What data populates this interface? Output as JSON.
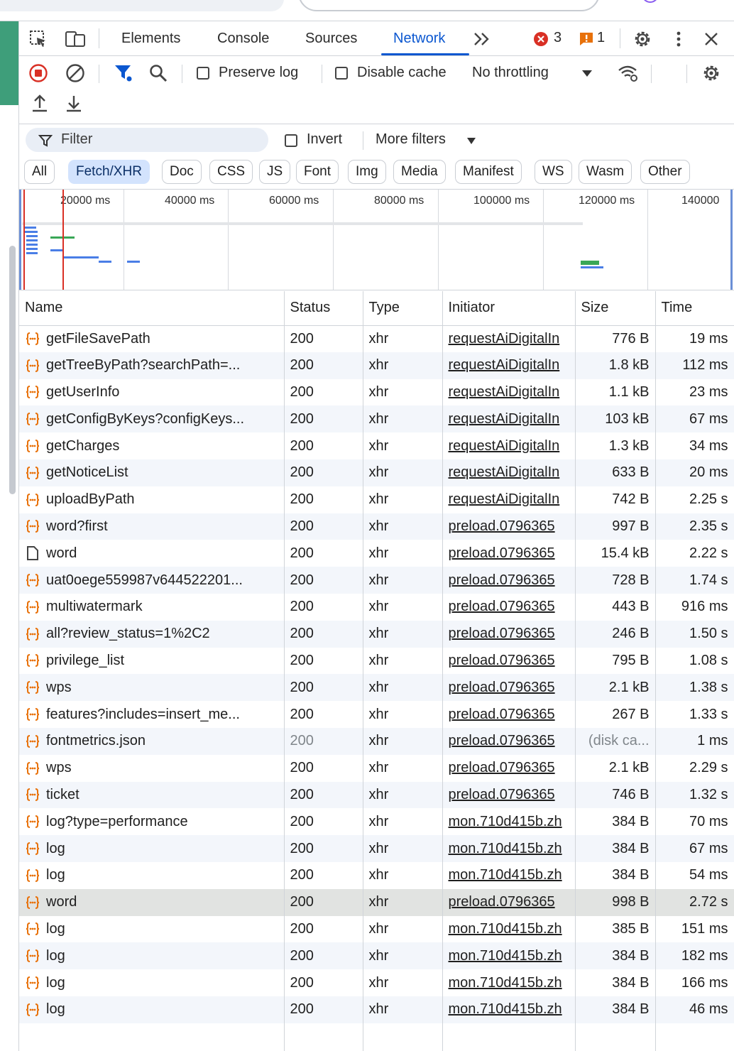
{
  "devtools": {
    "tabs": [
      "Elements",
      "Console",
      "Sources",
      "Network"
    ],
    "active_tab": "Network",
    "error_count": "3",
    "warning_count": "1"
  },
  "toolbar": {
    "preserve_log": "Preserve log",
    "disable_cache": "Disable cache",
    "throttling": "No throttling"
  },
  "filter": {
    "placeholder": "Filter",
    "invert": "Invert",
    "more_filters": "More filters",
    "chips": [
      "All",
      "Fetch/XHR",
      "Doc",
      "CSS",
      "JS",
      "Font",
      "Img",
      "Media",
      "Manifest",
      "WS",
      "Wasm",
      "Other"
    ],
    "active_chip": "Fetch/XHR"
  },
  "timeline": {
    "labels": [
      "20000 ms",
      "40000 ms",
      "60000 ms",
      "80000 ms",
      "100000 ms",
      "120000 ms",
      "140000"
    ]
  },
  "table": {
    "columns": [
      "Name",
      "Status",
      "Type",
      "Initiator",
      "Size",
      "Time"
    ],
    "rows": [
      {
        "icon": "fetch-icon",
        "name": "getFileSavePath",
        "status": "200",
        "type": "xhr",
        "initiator": "requestAiDigitalIn",
        "size": "776 B",
        "time": "19 ms"
      },
      {
        "icon": "fetch-icon",
        "name": "getTreeByPath?searchPath=...",
        "status": "200",
        "type": "xhr",
        "initiator": "requestAiDigitalIn",
        "size": "1.8 kB",
        "time": "112 ms"
      },
      {
        "icon": "fetch-icon",
        "name": "getUserInfo",
        "status": "200",
        "type": "xhr",
        "initiator": "requestAiDigitalIn",
        "size": "1.1 kB",
        "time": "23 ms"
      },
      {
        "icon": "fetch-icon",
        "name": "getConfigByKeys?configKeys...",
        "status": "200",
        "type": "xhr",
        "initiator": "requestAiDigitalIn",
        "size": "103 kB",
        "time": "67 ms"
      },
      {
        "icon": "fetch-icon",
        "name": "getCharges",
        "status": "200",
        "type": "xhr",
        "initiator": "requestAiDigitalIn",
        "size": "1.3 kB",
        "time": "34 ms"
      },
      {
        "icon": "fetch-icon",
        "name": "getNoticeList",
        "status": "200",
        "type": "xhr",
        "initiator": "requestAiDigitalIn",
        "size": "633 B",
        "time": "20 ms"
      },
      {
        "icon": "fetch-icon",
        "name": "uploadByPath",
        "status": "200",
        "type": "xhr",
        "initiator": "requestAiDigitalIn",
        "size": "742 B",
        "time": "2.25 s"
      },
      {
        "icon": "fetch-icon",
        "name": "word?first",
        "status": "200",
        "type": "xhr",
        "initiator": "preload.0796365",
        "size": "997 B",
        "time": "2.35 s"
      },
      {
        "icon": "document-icon",
        "name": "word",
        "status": "200",
        "type": "xhr",
        "initiator": "preload.0796365",
        "size": "15.4 kB",
        "time": "2.22 s"
      },
      {
        "icon": "fetch-icon",
        "name": "uat0oege559987v644522201...",
        "status": "200",
        "type": "xhr",
        "initiator": "preload.0796365",
        "size": "728 B",
        "time": "1.74 s"
      },
      {
        "icon": "fetch-icon",
        "name": "multiwatermark",
        "status": "200",
        "type": "xhr",
        "initiator": "preload.0796365",
        "size": "443 B",
        "time": "916 ms"
      },
      {
        "icon": "fetch-icon",
        "name": "all?review_status=1%2C2",
        "status": "200",
        "type": "xhr",
        "initiator": "preload.0796365",
        "size": "246 B",
        "time": "1.50 s"
      },
      {
        "icon": "fetch-icon",
        "name": "privilege_list",
        "status": "200",
        "type": "xhr",
        "initiator": "preload.0796365",
        "size": "795 B",
        "time": "1.08 s"
      },
      {
        "icon": "fetch-icon",
        "name": "wps",
        "status": "200",
        "type": "xhr",
        "initiator": "preload.0796365",
        "size": "2.1 kB",
        "time": "1.38 s"
      },
      {
        "icon": "fetch-icon",
        "name": "features?includes=insert_me...",
        "status": "200",
        "type": "xhr",
        "initiator": "preload.0796365",
        "size": "267 B",
        "time": "1.33 s"
      },
      {
        "icon": "fetch-icon",
        "name": "fontmetrics.json",
        "status": "200",
        "type": "xhr",
        "initiator": "preload.0796365",
        "size": "(disk ca...",
        "time": "1 ms",
        "cached": true
      },
      {
        "icon": "fetch-icon",
        "name": "wps",
        "status": "200",
        "type": "xhr",
        "initiator": "preload.0796365",
        "size": "2.1 kB",
        "time": "2.29 s"
      },
      {
        "icon": "fetch-icon",
        "name": "ticket",
        "status": "200",
        "type": "xhr",
        "initiator": "preload.0796365",
        "size": "746 B",
        "time": "1.32 s"
      },
      {
        "icon": "fetch-icon",
        "name": "log?type=performance",
        "status": "200",
        "type": "xhr",
        "initiator": "mon.710d415b.zh",
        "size": "384 B",
        "time": "70 ms"
      },
      {
        "icon": "fetch-icon",
        "name": "log",
        "status": "200",
        "type": "xhr",
        "initiator": "mon.710d415b.zh",
        "size": "384 B",
        "time": "67 ms"
      },
      {
        "icon": "fetch-icon",
        "name": "log",
        "status": "200",
        "type": "xhr",
        "initiator": "mon.710d415b.zh",
        "size": "384 B",
        "time": "54 ms"
      },
      {
        "icon": "fetch-icon",
        "name": "word",
        "status": "200",
        "type": "xhr",
        "initiator": "preload.0796365",
        "size": "998 B",
        "time": "2.72 s",
        "selected": true
      },
      {
        "icon": "fetch-icon",
        "name": "log",
        "status": "200",
        "type": "xhr",
        "initiator": "mon.710d415b.zh",
        "size": "385 B",
        "time": "151 ms"
      },
      {
        "icon": "fetch-icon",
        "name": "log",
        "status": "200",
        "type": "xhr",
        "initiator": "mon.710d415b.zh",
        "size": "384 B",
        "time": "182 ms"
      },
      {
        "icon": "fetch-icon",
        "name": "log",
        "status": "200",
        "type": "xhr",
        "initiator": "mon.710d415b.zh",
        "size": "384 B",
        "time": "166 ms"
      },
      {
        "icon": "fetch-icon",
        "name": "log",
        "status": "200",
        "type": "xhr",
        "initiator": "mon.710d415b.zh",
        "size": "384 B",
        "time": "46 ms"
      }
    ]
  },
  "colors": {
    "accent": "#0b57d0",
    "error": "#d93025",
    "warning": "#e8710a",
    "fetch_icon": "#e8710a"
  }
}
